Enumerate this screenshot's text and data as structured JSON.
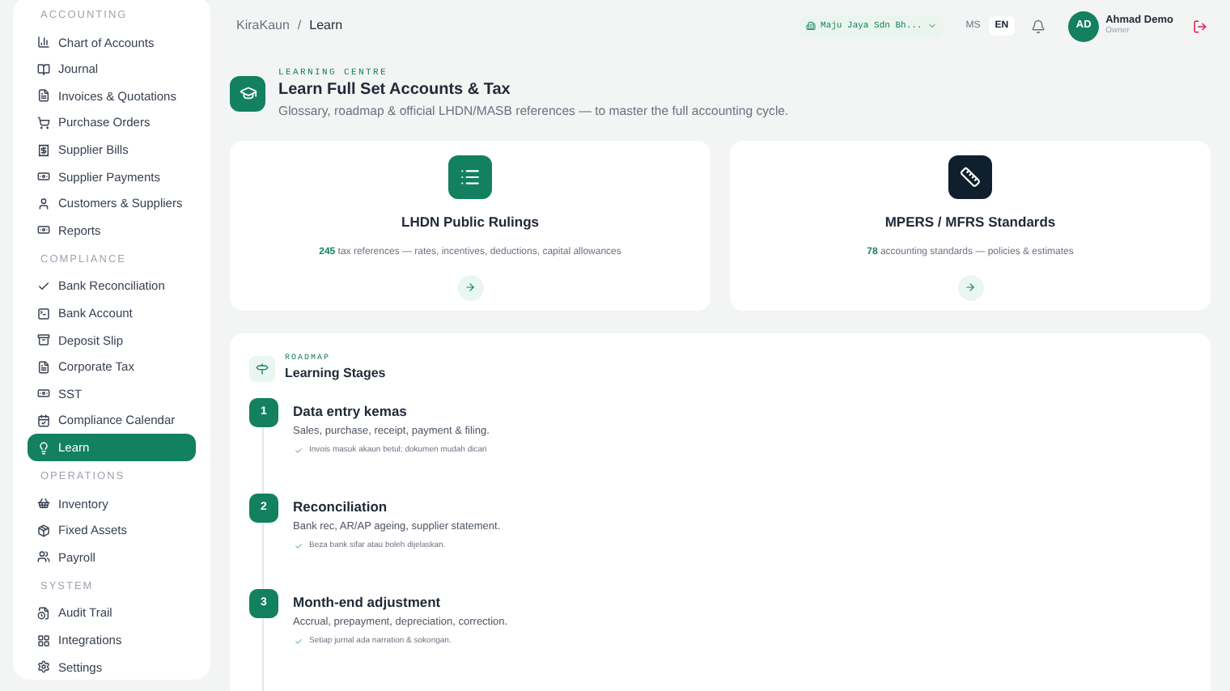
{
  "sidebar": {
    "sections": [
      {
        "label": "ACCOUNTING",
        "items": [
          {
            "label": "Chart of Accounts",
            "kind": "chart",
            "selected": false
          },
          {
            "label": "Journal",
            "kind": "book",
            "selected": false
          },
          {
            "label": "Invoices & Quotations",
            "kind": "file",
            "selected": false
          },
          {
            "label": "Purchase Orders",
            "kind": "cart",
            "selected": false
          },
          {
            "label": "Supplier Bills",
            "kind": "receipt",
            "selected": false
          },
          {
            "label": "Supplier Payments",
            "kind": "cash",
            "selected": false
          },
          {
            "label": "Customers & Suppliers",
            "kind": "user",
            "selected": false
          },
          {
            "label": "Reports",
            "kind": "cash",
            "selected": false
          }
        ]
      },
      {
        "label": "COMPLIANCE",
        "items": [
          {
            "label": "Bank Reconciliation",
            "kind": "check",
            "selected": false
          },
          {
            "label": "Bank Account",
            "kind": "terminal",
            "selected": false
          },
          {
            "label": "Deposit Slip",
            "kind": "archive",
            "selected": false
          },
          {
            "label": "Corporate Tax",
            "kind": "file",
            "selected": false
          },
          {
            "label": "SST",
            "kind": "cash",
            "selected": false
          },
          {
            "label": "Compliance Calendar",
            "kind": "calendar",
            "selected": false
          },
          {
            "label": "Learn",
            "kind": "bulb",
            "selected": true
          }
        ]
      },
      {
        "label": "OPERATIONS",
        "items": [
          {
            "label": "Inventory",
            "kind": "basket",
            "selected": false
          },
          {
            "label": "Fixed Assets",
            "kind": "box",
            "selected": false
          },
          {
            "label": "Payroll",
            "kind": "users",
            "selected": false
          }
        ]
      },
      {
        "label": "SYSTEM",
        "items": [
          {
            "label": "Audit Trail",
            "kind": "audit",
            "selected": false
          },
          {
            "label": "Integrations",
            "kind": "grid",
            "selected": false
          },
          {
            "label": "Settings",
            "kind": "gear",
            "selected": false
          }
        ]
      }
    ]
  },
  "breadcrumb": [
    "KiraKaun",
    "/",
    "Learn"
  ],
  "company": "Maju Jaya Sdn Bh...",
  "languages": [
    {
      "label": "MS",
      "selected": false
    },
    {
      "label": "EN",
      "selected": true
    }
  ],
  "user": {
    "initials": "AD",
    "name": "Ahmad Demo",
    "role": "Owner"
  },
  "hero": {
    "eyebrow": "LEARNING CENTRE",
    "title": "Learn Full Set Accounts & Tax",
    "subtitle": "Glossary, roadmap & official LHDN/MASB references — to master the full accounting cycle."
  },
  "cards": [
    {
      "kind": "rulings",
      "title": "LHDN Public Rulings",
      "count": "245",
      "text": "tax references — rates, incentives, deductions, capital allowances"
    },
    {
      "kind": "standards",
      "title": "MPERS / MFRS Standards",
      "count": "78",
      "text": "accounting standards — policies & estimates"
    }
  ],
  "roadmap": {
    "eyebrow": "ROADMAP",
    "title": "Learning Stages",
    "stages": [
      {
        "number": "1",
        "title": "Data entry kemas",
        "description": "Sales, purchase, receipt, payment & filing.",
        "note": "Invois masuk akaun betul; dokumen mudah dicari"
      },
      {
        "number": "2",
        "title": "Reconciliation",
        "description": "Bank rec, AR/AP ageing, supplier statement.",
        "note": "Beza bank sifar atau boleh dijelaskan."
      },
      {
        "number": "3",
        "title": "Month-end adjustment",
        "description": "Accrual, prepayment, depreciation, correction.",
        "note": "Setiap jurnal ada narration & sokongan."
      }
    ]
  }
}
